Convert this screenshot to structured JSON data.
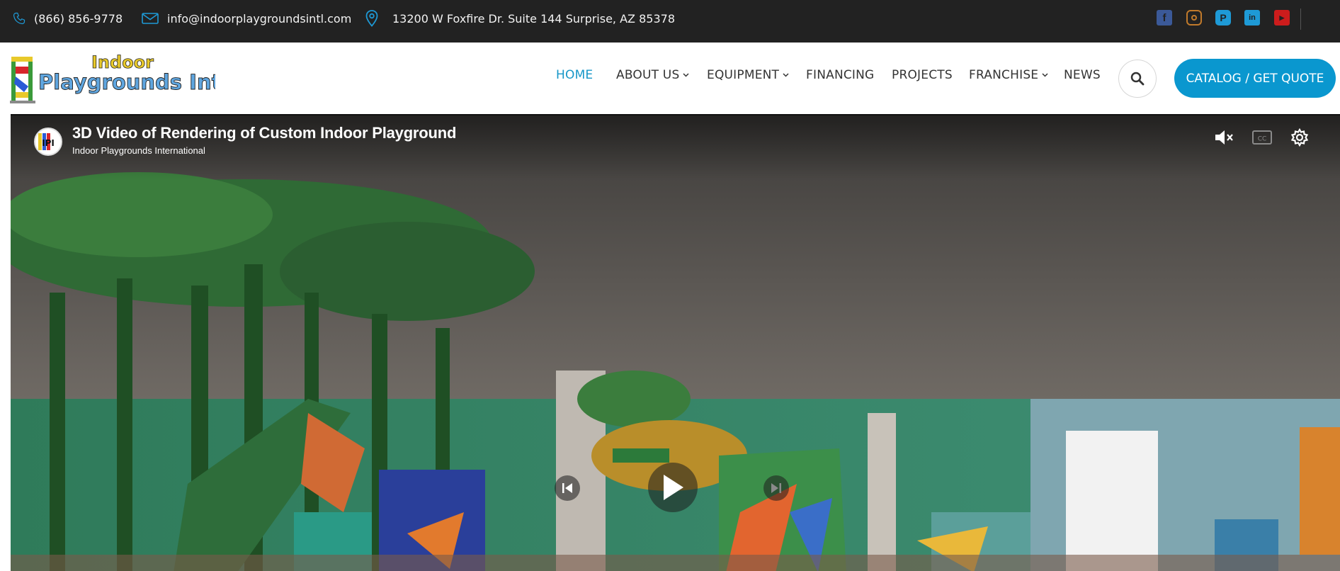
{
  "topbar": {
    "phone": "(866) 856-9778",
    "email": "info@indoorplaygroundsintl.com",
    "address": "13200 W Foxfire Dr. Suite 144 Surprise, AZ 85378",
    "social": [
      {
        "name": "facebook-icon",
        "color": "#3b5998"
      },
      {
        "name": "instagram-icon",
        "color": "#c17a2b"
      },
      {
        "name": "pinterest-icon",
        "color": "#1e9ad6"
      },
      {
        "name": "linkedin-icon",
        "color": "#1e9ad6"
      },
      {
        "name": "youtube-icon",
        "color": "#cc1c1c"
      }
    ]
  },
  "header": {
    "logo_text_line1": "Indoor",
    "logo_text_line2": "Playgrounds Int'l",
    "nav": [
      "HOME",
      "ABOUT US",
      "EQUIPMENT",
      "FINANCING",
      "PROJECTS",
      "FRANCHISE",
      "NEWS"
    ],
    "active_nav": "HOME",
    "cta_label": "CATALOG / GET QUOTE",
    "accent_color": "#0a97cf"
  },
  "video": {
    "title": "3D Video of Rendering of Custom Indoor Playground",
    "channel": "Indoor Playgrounds International",
    "avatar_text": "IPI"
  }
}
